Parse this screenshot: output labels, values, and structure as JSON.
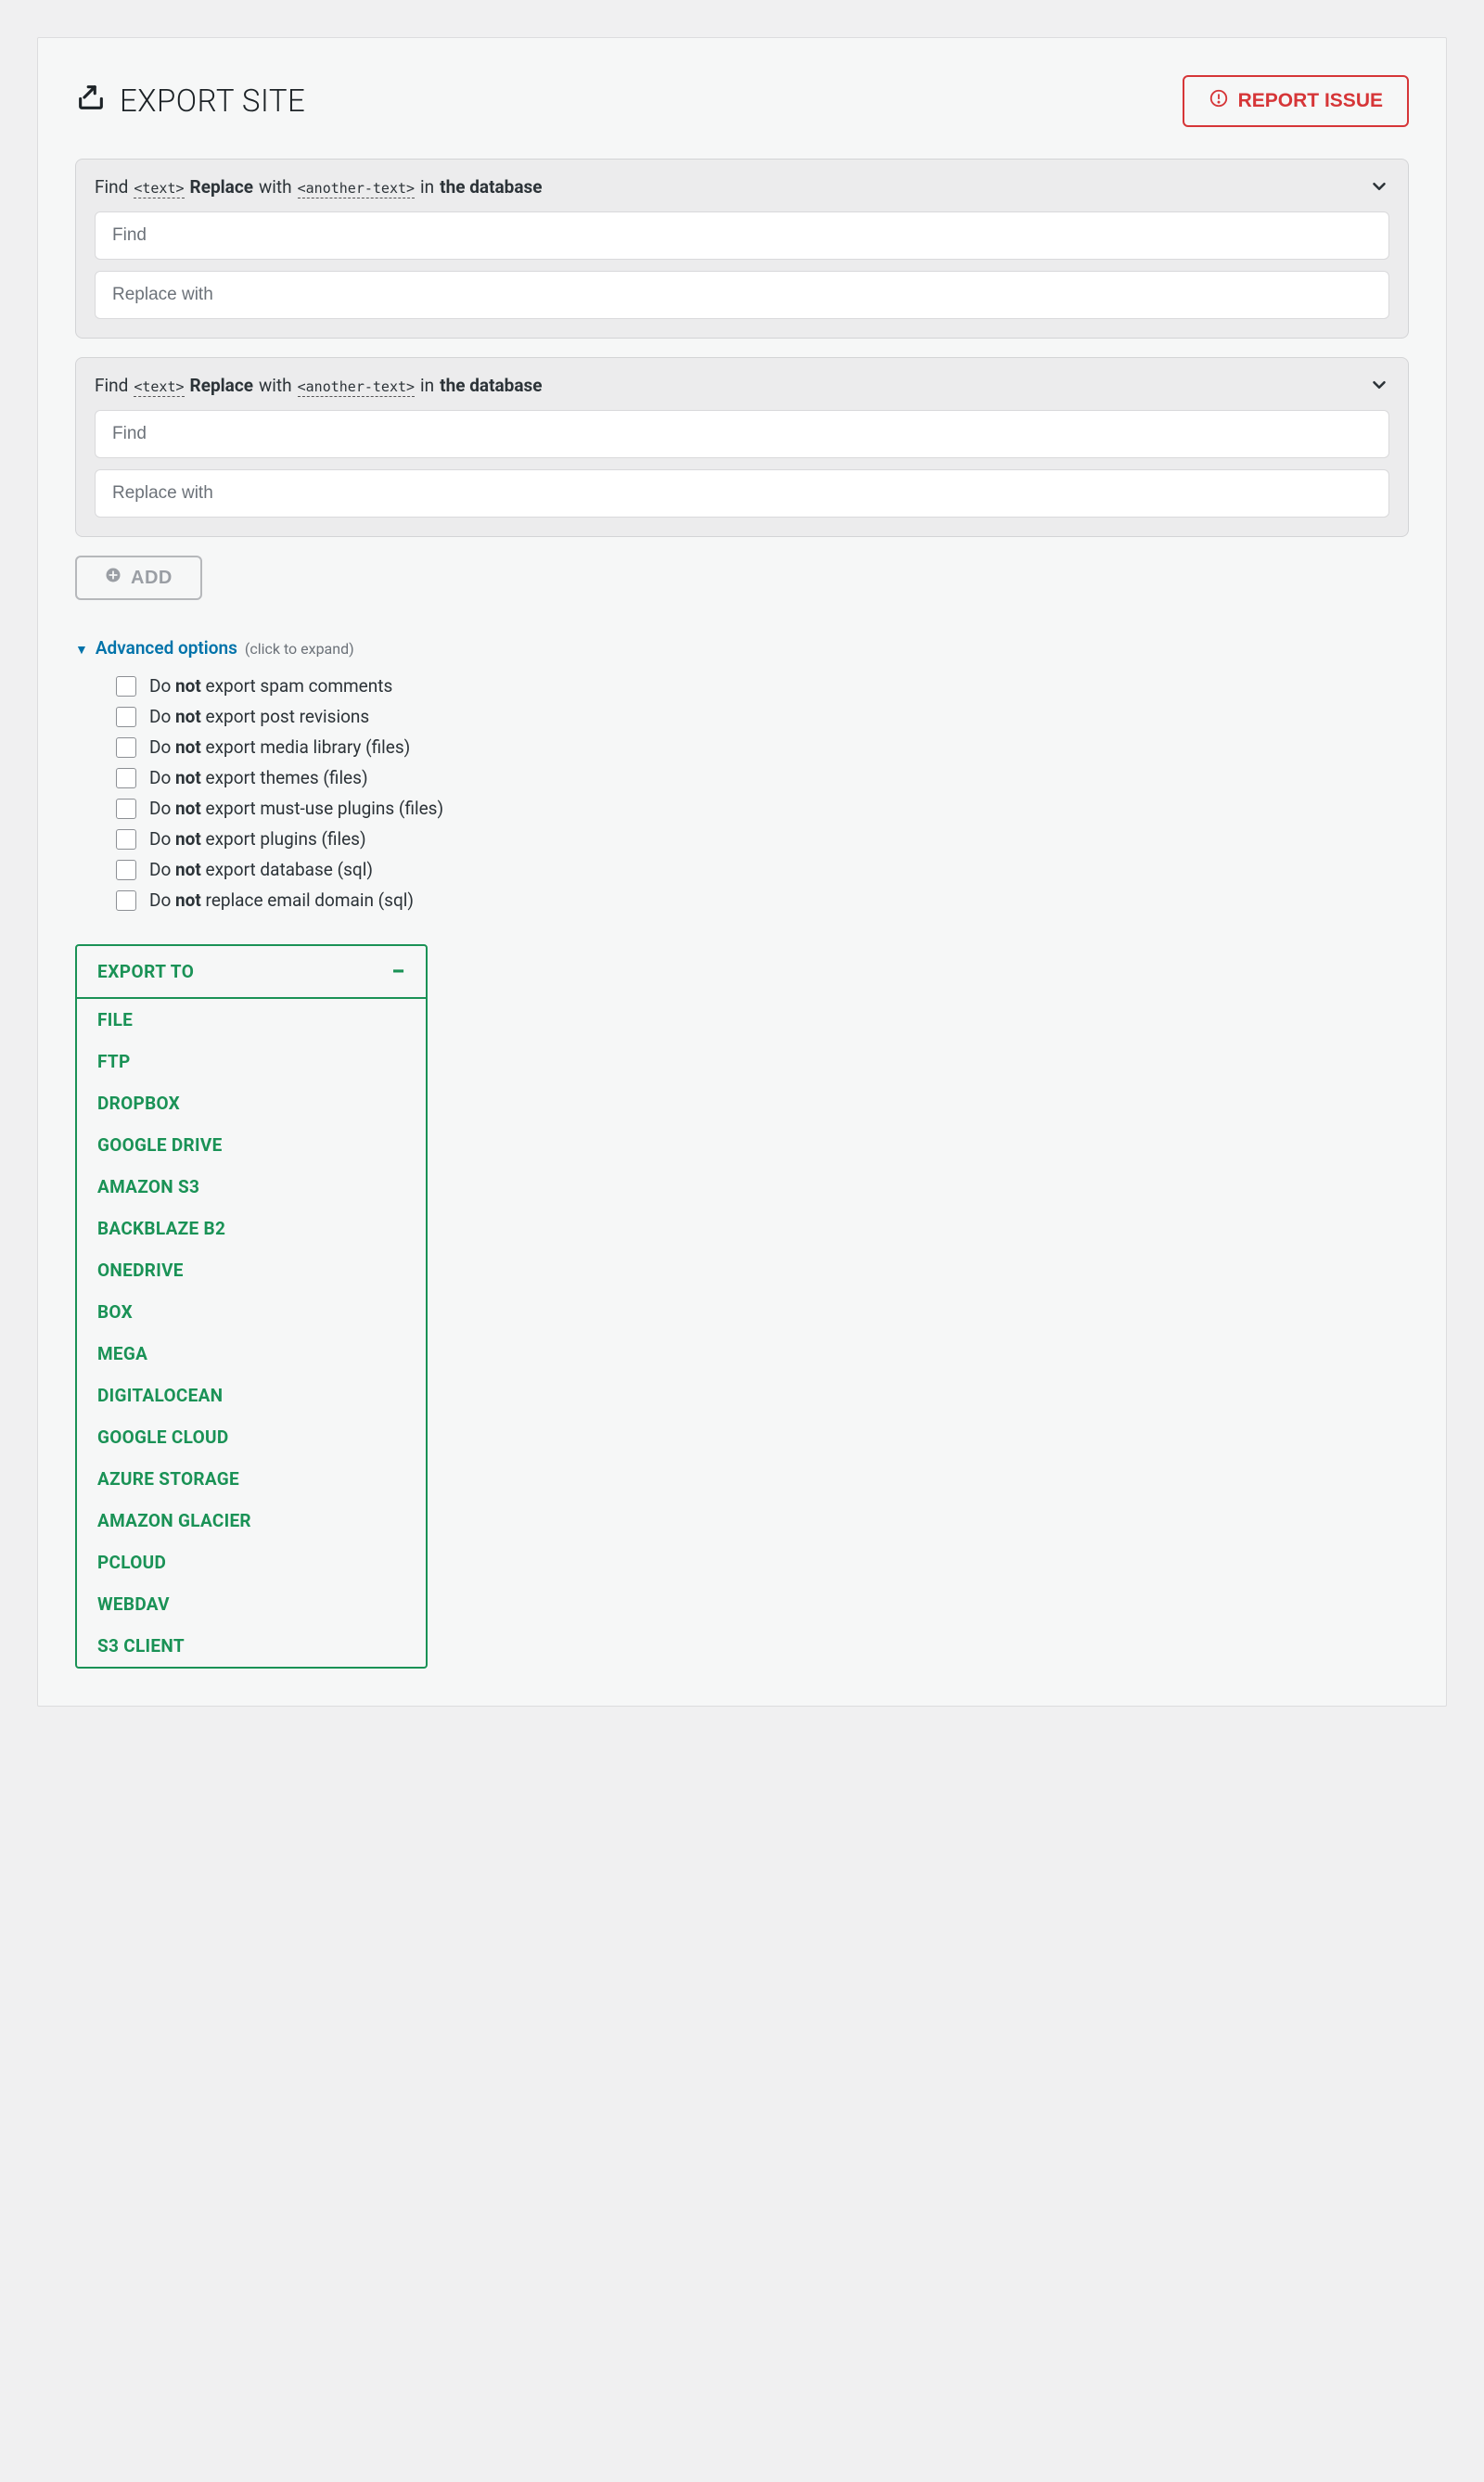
{
  "header": {
    "title": "EXPORT SITE",
    "report_label": "REPORT ISSUE"
  },
  "find_replace": {
    "head": {
      "find": "Find",
      "tag1": "<text>",
      "replace": "Replace",
      "with": "with",
      "tag2": "<another-text>",
      "rest": "in",
      "rest2": "the database"
    },
    "find_placeholder": "Find",
    "replace_placeholder": "Replace with",
    "add_label": "ADD"
  },
  "advanced": {
    "label": "Advanced options",
    "hint": "(click to expand)",
    "options": [
      {
        "pre": "Do ",
        "bold": "not",
        "post": " export spam comments"
      },
      {
        "pre": "Do ",
        "bold": "not",
        "post": " export post revisions"
      },
      {
        "pre": "Do ",
        "bold": "not",
        "post": " export media library (files)"
      },
      {
        "pre": "Do ",
        "bold": "not",
        "post": " export themes (files)"
      },
      {
        "pre": "Do ",
        "bold": "not",
        "post": " export must-use plugins (files)"
      },
      {
        "pre": "Do ",
        "bold": "not",
        "post": " export plugins (files)"
      },
      {
        "pre": "Do ",
        "bold": "not",
        "post": " export database (sql)"
      },
      {
        "pre": "Do ",
        "bold": "not",
        "post": " replace email domain (sql)"
      }
    ]
  },
  "export": {
    "title": "EXPORT TO",
    "items": [
      "FILE",
      "FTP",
      "DROPBOX",
      "GOOGLE DRIVE",
      "AMAZON S3",
      "BACKBLAZE B2",
      "ONEDRIVE",
      "BOX",
      "MEGA",
      "DIGITALOCEAN",
      "GOOGLE CLOUD",
      "AZURE STORAGE",
      "AMAZON GLACIER",
      "PCLOUD",
      "WEBDAV",
      "S3 CLIENT"
    ]
  }
}
